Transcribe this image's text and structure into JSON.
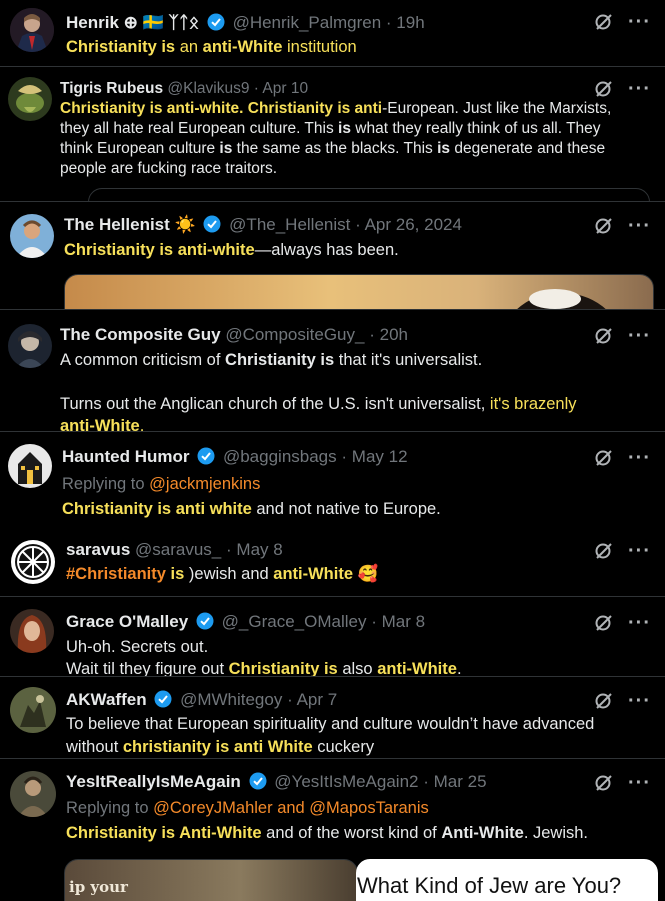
{
  "posts": [
    {
      "name": "Henrik ⊕ 🇸🇪 ᛉᛏᛟ",
      "handle": "@Henrik_Palmgren",
      "time": "19h",
      "body": [
        [
          {
            "t": "Christianity is",
            "c": "hl"
          },
          {
            "t": " an ",
            "c": "hlp"
          },
          {
            "t": "anti-White",
            "c": "hl"
          },
          {
            "t": " institution",
            "c": "hlp"
          }
        ]
      ]
    },
    {
      "name": "Tigris Rubeus",
      "handle": "@Klavikus9",
      "time": "Apr 10",
      "body": [
        [
          {
            "t": "Christianity is anti-white. Christianity is anti",
            "c": "hl"
          },
          {
            "t": "-European. Just like the Marxists, they all hate real European culture. This "
          },
          {
            "t": "is",
            "c": "b"
          },
          {
            "t": " what they really think of us all. They think European culture "
          },
          {
            "t": "is",
            "c": "b"
          },
          {
            "t": " the same as the blacks. This "
          },
          {
            "t": "is",
            "c": "b"
          },
          {
            "t": " degenerate and these people are fucking race traitors."
          }
        ]
      ]
    },
    {
      "name": "The Hellenist ☀️",
      "handle": "@The_Hellenist",
      "time": "Apr 26, 2024",
      "body": [
        [
          {
            "t": "Christianity is anti-white",
            "c": "hl"
          },
          {
            "t": "—always has been."
          }
        ]
      ]
    },
    {
      "name": "The Composite Guy",
      "handle": "@CompositeGuy_",
      "time": "20h",
      "body": [
        [
          {
            "t": "A common criticism of "
          },
          {
            "t": "Christianity is",
            "c": "b"
          },
          {
            "t": " that it's universalist."
          }
        ],
        [],
        [
          {
            "t": "Turns out the Anglican church of the U.S. isn't universalist, "
          },
          {
            "t": "it's brazenly",
            "c": "hlp"
          }
        ],
        [
          {
            "t": "anti-White",
            "c": "hl"
          },
          {
            "t": ".",
            "c": "hlp"
          }
        ]
      ]
    },
    {
      "name": "Haunted Humor",
      "handle": "@bagginsbags",
      "time": "May 12",
      "replying": "Replying to",
      "reply_to": "@jackmjenkins",
      "body": [
        [
          {
            "t": "Christianity is anti white",
            "c": "hl"
          },
          {
            "t": " and not native to Europe."
          }
        ]
      ]
    },
    {
      "name": "saravus",
      "handle": "@saravus_",
      "time": "May 8",
      "body": [
        [
          {
            "t": "#Christianity",
            "c": "orange b"
          },
          {
            "t": " is",
            "c": "hl"
          },
          {
            "t": " )ewish and "
          },
          {
            "t": "anti-White",
            "c": "hl"
          },
          {
            "t": " 🥰"
          }
        ]
      ]
    },
    {
      "name": "Grace O'Malley",
      "handle": "@_Grace_OMalley",
      "time": "Mar 8",
      "body": [
        [
          {
            "t": "Uh-oh. Secrets out."
          }
        ],
        [
          {
            "t": "Wait til they figure out "
          },
          {
            "t": "Christianity is",
            "c": "hl"
          },
          {
            "t": " also "
          },
          {
            "t": "anti-White",
            "c": "hl"
          },
          {
            "t": "."
          }
        ]
      ]
    },
    {
      "name": "AKWaffen",
      "handle": "@MWhitegoy",
      "time": "Apr 7",
      "body": [
        [
          {
            "t": "To believe that European spirituality and culture wouldn’t have advanced without "
          },
          {
            "t": "christianity is anti White",
            "c": "hl"
          },
          {
            "t": " cuckery"
          }
        ]
      ]
    },
    {
      "name": "YesItReallyIsMeAgain",
      "handle": "@YesItIsMeAgain2",
      "time": "Mar 25",
      "replying": "Replying to",
      "reply_to": "@CoreyJMahler and @MaposTaranis",
      "body": [
        [
          {
            "t": "Christianity is Anti-White",
            "c": "hl"
          },
          {
            "t": " and of the worst kind of "
          },
          {
            "t": "Anti-White",
            "c": "b"
          },
          {
            "t": ".  Jewish."
          }
        ]
      ]
    }
  ],
  "media": {
    "card_left_text": "ip your",
    "card_right_text": "What Kind of Jew are You?"
  },
  "colors": {
    "highlight": "#f7e05a",
    "hashtag": "#f48a2a",
    "muted": "#71767b",
    "verified": "#1d9bf0"
  },
  "icons": {
    "grok": "grok-icon",
    "more": "more-dots-icon",
    "verified": "verified-badge-icon"
  }
}
